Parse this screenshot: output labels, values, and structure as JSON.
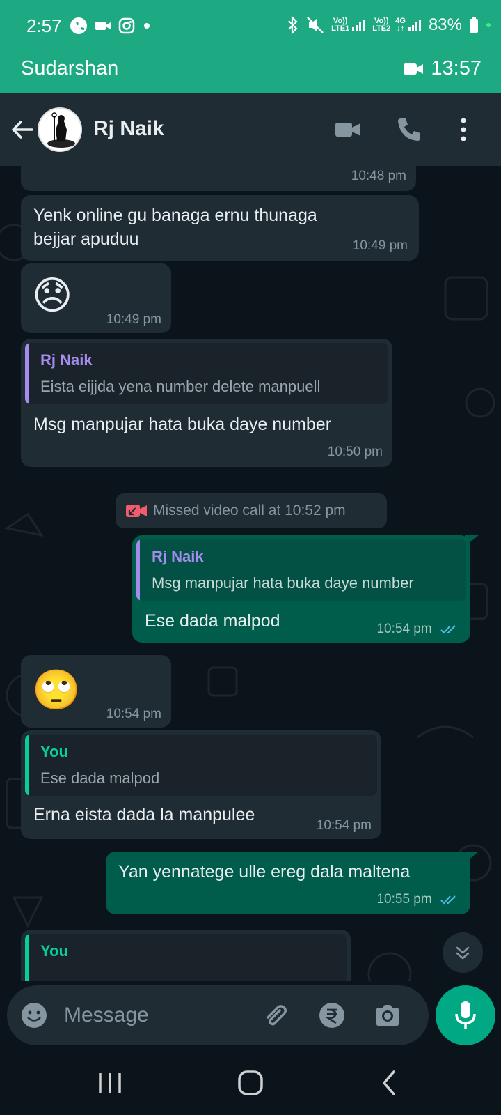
{
  "status_bar": {
    "time": "2:57",
    "battery": "83%",
    "sim1": "LTE1",
    "sim2": "LTE2",
    "net": "4G",
    "vol": "Vo))"
  },
  "call_banner": {
    "name": "Sudarshan",
    "duration": "13:57"
  },
  "header": {
    "contact_name": "Rj Naik"
  },
  "messages": [
    {
      "time": "10:48 pm"
    },
    {
      "text_line1": "Yenk online gu banaga ernu thunaga",
      "text_line2": "bejjar apuduu",
      "time": "10:49 pm"
    },
    {
      "emoji": "😞",
      "time": "10:49 pm"
    },
    {
      "quote_name": "Rj Naik",
      "quote_text": "Eista eijjda yena number delete manpuell",
      "text": "Msg manpujar hata buka daye number",
      "time": "10:50 pm"
    },
    {
      "system": "Missed video call at 10:52 pm"
    },
    {
      "quote_name": "Rj Naik",
      "quote_text": "Msg manpujar hata buka daye number",
      "text": "Ese dada malpod",
      "time": "10:54 pm"
    },
    {
      "emoji": "🙄",
      "time": "10:54 pm"
    },
    {
      "quote_name": "You",
      "quote_text": "Ese dada malpod",
      "text": "Erna eista dada la manpulee",
      "time": "10:54 pm"
    },
    {
      "text": "Yan yennatege ulle ereg dala maltena",
      "time": "10:55 pm"
    },
    {
      "quote_name": "You"
    }
  ],
  "input": {
    "placeholder": "Message"
  },
  "colors": {
    "call_green": "#1daa83",
    "header_bg": "#1f2c34",
    "chat_bg": "#0b141a",
    "incoming": "#1f2c34",
    "outgoing": "#005c4b",
    "quote_purple": "#a68cf0",
    "quote_you": "#06cf9c",
    "read_ticks": "#53bdeb",
    "missed_red": "#f15c6d",
    "mic_green": "#00a884"
  }
}
